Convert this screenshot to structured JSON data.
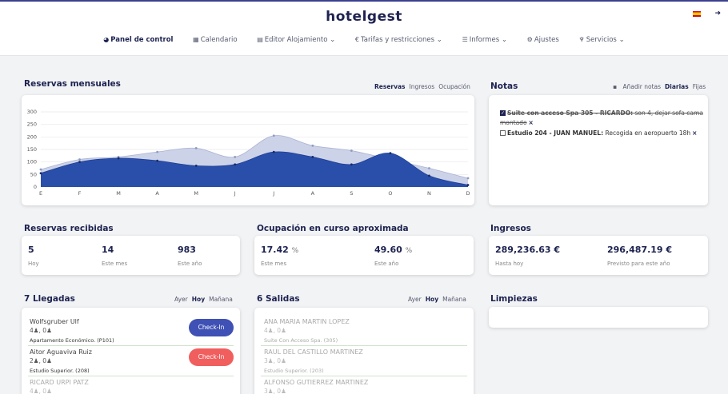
{
  "header": {
    "logo": "hotelgest",
    "lang_flag": "spain-flag",
    "logout_icon": "logout-icon"
  },
  "nav": [
    {
      "label": "Panel de control",
      "icon": "dashboard-icon",
      "glyph": "◕",
      "active": true
    },
    {
      "label": "Calendario",
      "icon": "calendar-icon",
      "glyph": "▦"
    },
    {
      "label": "Editor Alojamiento ⌄",
      "icon": "building-icon",
      "glyph": "▤"
    },
    {
      "label": "Tarifas y restricciones ⌄",
      "icon": "euro-icon",
      "glyph": "€"
    },
    {
      "label": "Informes ⌄",
      "icon": "list-icon",
      "glyph": "☰"
    },
    {
      "label": "Ajustes",
      "icon": "gear-icon",
      "glyph": "⚙"
    },
    {
      "label": "Servicios ⌄",
      "icon": "cutlery-icon",
      "glyph": "♆"
    }
  ],
  "reservas_mensuales": {
    "title": "Reservas mensuales",
    "tabs": [
      "Reservas",
      "Ingresos",
      "Ocupación"
    ]
  },
  "chart_data": {
    "type": "area",
    "categories": [
      "E",
      "F",
      "M",
      "A",
      "M",
      "J",
      "J",
      "A",
      "S",
      "O",
      "N",
      "D"
    ],
    "series": [
      {
        "values": [
          70,
          110,
          120,
          140,
          155,
          120,
          205,
          165,
          145,
          110,
          75,
          35
        ],
        "color": "#c9d0e6"
      },
      {
        "values": [
          55,
          100,
          115,
          105,
          85,
          90,
          140,
          120,
          90,
          135,
          45,
          8
        ],
        "color": "#2a4fab"
      }
    ],
    "ylim": [
      0,
      300
    ],
    "yticks": [
      0,
      50,
      100,
      150,
      200,
      250,
      300
    ],
    "grid": true
  },
  "notas": {
    "title": "Notas",
    "add_label": "Añadir notas",
    "tabs": [
      "Diarias",
      "Fijas"
    ],
    "items": [
      {
        "checked": true,
        "bold": "Suite con acceso Spa 305 - RICARDO:",
        "text": " son 4, dejar sofa cama",
        "text2": "montado"
      },
      {
        "checked": false,
        "bold": "Estudio 204 - JUAN MANUEL:",
        "text": " Recogida en aeropuerto 18h"
      }
    ]
  },
  "reservas_recibidas": {
    "title": "Reservas recibidas",
    "stats": [
      {
        "value": "5",
        "label": "Hoy"
      },
      {
        "value": "14",
        "label": "Este mes"
      },
      {
        "value": "983",
        "label": "Este año"
      }
    ]
  },
  "ocupacion": {
    "title": "Ocupación en curso aproximada",
    "stats": [
      {
        "value": "17.42",
        "unit": "%",
        "label": "Este mes"
      },
      {
        "value": "49.60",
        "unit": "%",
        "label": "Este año"
      }
    ]
  },
  "ingresos": {
    "title": "Ingresos",
    "stats": [
      {
        "value": "289,236.63 €",
        "label": "Hasta hoy"
      },
      {
        "value": "296,487.19 €",
        "label": "Previsto para este año"
      }
    ]
  },
  "llegadas": {
    "title": "7 Llegadas",
    "tabs": [
      "Ayer",
      "Hoy",
      "Mañana"
    ],
    "guests": [
      {
        "name": "Wolfsgruber Ulf",
        "adults": "4",
        "kids": "0",
        "room": "Apartamento Económico. (P101)",
        "button": "Check-In"
      },
      {
        "name": "Aitor Aguaviva Ruiz",
        "adults": "2",
        "kids": "0",
        "room": "Estudio Superior. (208)",
        "button": "Check-In"
      },
      {
        "name": "RICARD URPI PATZ",
        "adults": "4",
        "kids": "0"
      }
    ]
  },
  "salidas": {
    "title": "6 Salidas",
    "tabs": [
      "Ayer",
      "Hoy",
      "Mañana"
    ],
    "guests": [
      {
        "name": "ANA MARIA MARTIN LOPEZ",
        "adults": "4",
        "kids": "0",
        "room": "Suite Con Acceso Spa. (305)"
      },
      {
        "name": "RAUL DEL CASTILLO MARTINEZ",
        "adults": "3",
        "kids": "0",
        "room": "Estudio Superior. (203)"
      },
      {
        "name": "ALFONSO GUTIERREZ MARTINEZ",
        "adults": "3",
        "kids": "0"
      }
    ]
  },
  "limpiezas": {
    "title": "Limpiezas"
  }
}
